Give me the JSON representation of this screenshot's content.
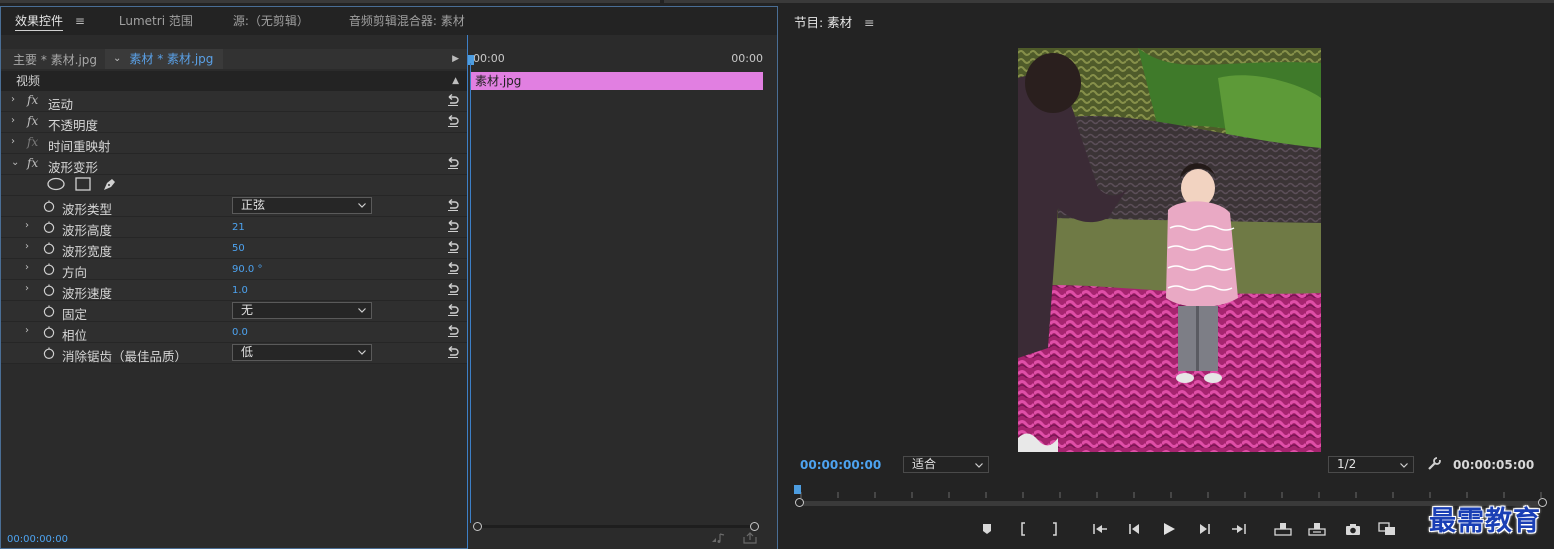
{
  "left_panel": {
    "tabs": [
      {
        "label": "效果控件"
      },
      {
        "label": "Lumetri 范围"
      },
      {
        "label": "源:（无剪辑）"
      },
      {
        "label": "音频剪辑混合器: 素材"
      }
    ],
    "clip_master": "主要 * 素材.jpg",
    "clip_current": "素材 * 素材.jpg",
    "video_header": "视频",
    "effects": [
      {
        "label": "运动"
      },
      {
        "label": "不透明度"
      },
      {
        "label": "时间重映射"
      },
      {
        "label": "波形变形"
      }
    ],
    "properties": {
      "wave_type": {
        "label": "波形类型",
        "value": "正弦"
      },
      "wave_height": {
        "label": "波形高度",
        "value": "21"
      },
      "wave_width": {
        "label": "波形宽度",
        "value": "50"
      },
      "direction": {
        "label": "方向",
        "value": "90.0 °"
      },
      "wave_speed": {
        "label": "波形速度",
        "value": "1.0"
      },
      "pinning": {
        "label": "固定",
        "value": "无"
      },
      "phase": {
        "label": "相位",
        "value": "0.0"
      },
      "antialias": {
        "label": "消除锯齿（最佳品质）",
        "value": "低"
      }
    },
    "timecode": "00:00:00:00",
    "timeline": {
      "tc_left": "00:00",
      "tc_right": "00:00",
      "clip_label": "素材.jpg",
      "clip_color": "#e17fe1"
    }
  },
  "monitor": {
    "title": "节目: 素材",
    "timecode_current": "00:00:00:00",
    "fit_select": "适合",
    "resolution_select": "1/2",
    "timecode_duration": "00:00:05:00"
  },
  "watermark": "最需教育",
  "colors": {
    "accent": "#4da3f0",
    "panel_border": "#4a6e95"
  }
}
